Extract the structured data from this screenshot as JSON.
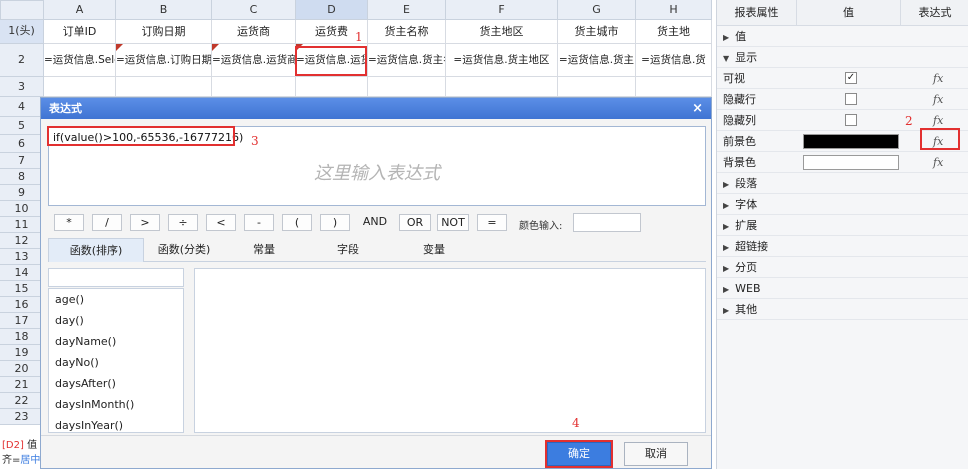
{
  "sheet": {
    "columns": [
      "A",
      "B",
      "C",
      "D",
      "E",
      "F",
      "G",
      "H"
    ],
    "row1_label": "1(头)",
    "row_labels": [
      "2",
      "3",
      "4",
      "5",
      "6",
      "7",
      "8",
      "9",
      "10",
      "11",
      "12",
      "13",
      "14",
      "15",
      "16",
      "17",
      "18",
      "19",
      "20",
      "21",
      "22",
      "23"
    ],
    "headers": [
      "订单ID",
      "订购日期",
      "运货商",
      "运货费",
      "货主名称",
      "货主地区",
      "货主城市",
      "货主地"
    ],
    "formulas": [
      "=运货信息.Sele",
      "=运货信息.订购日期",
      "=运货信息.运货商",
      "=运货信息.运货",
      "=运货信息.货主名",
      "=运货信息.货主地区",
      "=运货信息.货主",
      "=运货信息.货"
    ],
    "status_cell": "[D2]",
    "status_cell_suffix": "值",
    "status_align": "齐=",
    "status_align_value": "居中"
  },
  "annotations": [
    "1",
    "2",
    "3",
    "4"
  ],
  "dialog": {
    "title": "表达式",
    "close": "×",
    "expression": "if(value()>100,-65536,-16777216)",
    "placeholder": "这里输入表达式",
    "operators": [
      "*",
      "/",
      ">",
      "÷",
      "<",
      "-",
      "(",
      ")",
      "AND",
      "OR",
      "NOT",
      "="
    ],
    "color_label": "颜色输入:",
    "tabs": [
      "函数(排序)",
      "函数(分类)",
      "常量",
      "字段",
      "变量"
    ],
    "functions": [
      "age()",
      "day()",
      "dayName()",
      "dayNo()",
      "daysAfter()",
      "daysInMonth()",
      "daysInYear()"
    ],
    "ok": "确定",
    "cancel": "取消"
  },
  "panel": {
    "headers": [
      "报表属性",
      "值",
      "表达式"
    ],
    "sections": {
      "value": "值",
      "display": "显示",
      "paragraph": "段落",
      "font": "字体",
      "extend": "扩展",
      "hyperlink": "超链接",
      "paging": "分页",
      "web": "WEB",
      "other": "其他"
    },
    "props": [
      "可视",
      "隐藏行",
      "隐藏列",
      "前景色",
      "背景色"
    ],
    "fx": "fx",
    "visible_checked": "✓"
  },
  "colors": {
    "accent": "#3c7de0",
    "highlight": "#e23030",
    "foreground_swatch": "#000000",
    "background_swatch": "#ffffff"
  }
}
